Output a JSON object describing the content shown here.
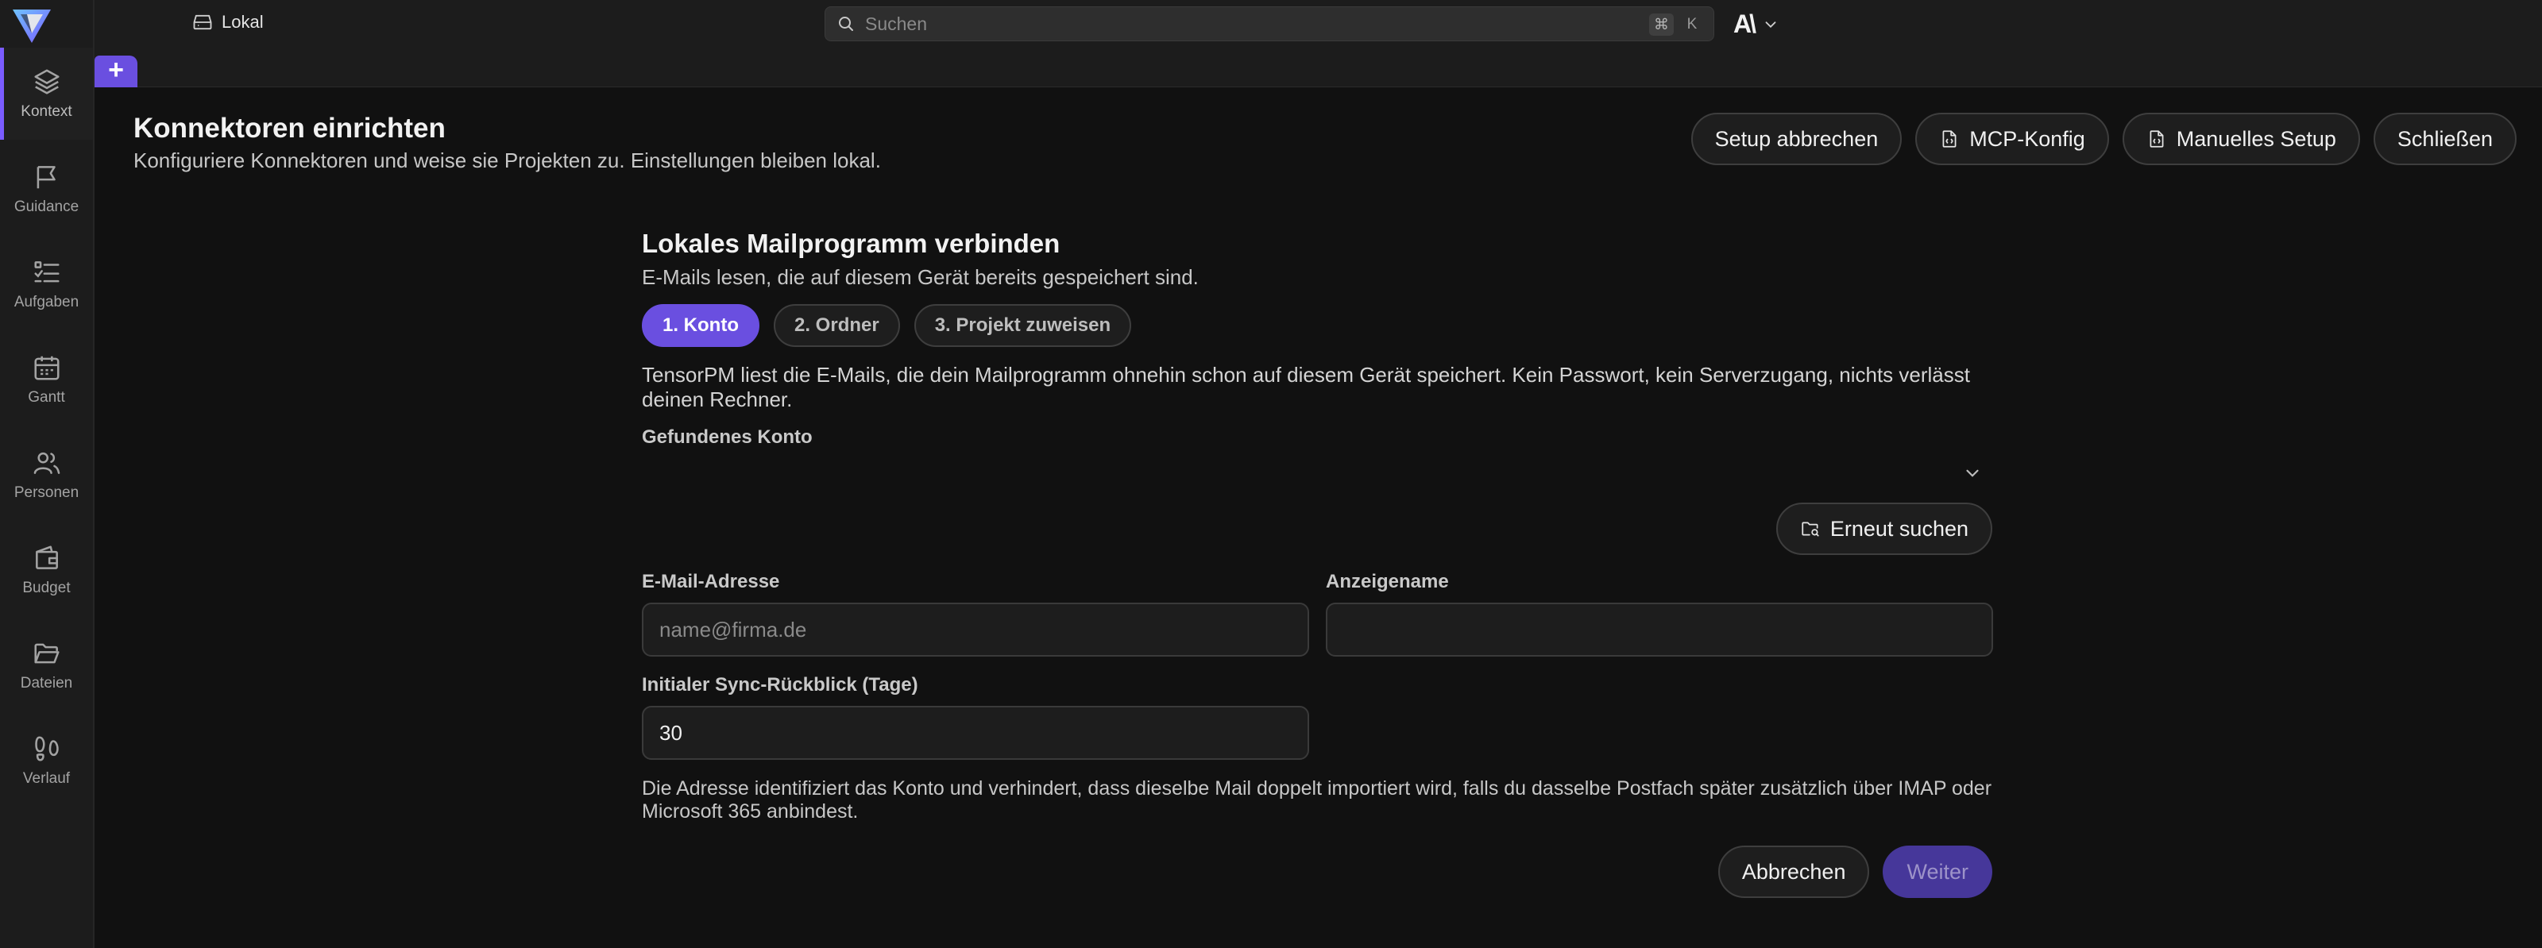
{
  "sidebar": {
    "items": [
      {
        "label": "Kontext",
        "icon": "layers-icon",
        "active": true
      },
      {
        "label": "Guidance",
        "icon": "flag-icon"
      },
      {
        "label": "Aufgaben",
        "icon": "checklist-icon"
      },
      {
        "label": "Gantt",
        "icon": "calendar-icon"
      },
      {
        "label": "Personen",
        "icon": "people-icon"
      },
      {
        "label": "Budget",
        "icon": "wallet-icon"
      },
      {
        "label": "Dateien",
        "icon": "folder-icon"
      },
      {
        "label": "Verlauf",
        "icon": "footsteps-icon"
      }
    ]
  },
  "topbar": {
    "location": "Lokal",
    "search_placeholder": "Suchen",
    "shortcut_modifier": "⌘",
    "shortcut_key": "K",
    "brand_mark": "A\\"
  },
  "tabs": {
    "add_label": "+"
  },
  "header": {
    "title": "Konnektoren einrichten",
    "subtitle": "Konfiguriere Konnektoren und weise sie Projekten zu. Einstellungen bleiben lokal.",
    "actions": {
      "cancel_setup": "Setup abbrechen",
      "mcp_config": "MCP-Konfig",
      "manual_setup": "Manuelles Setup",
      "close": "Schließen"
    }
  },
  "form": {
    "title": "Lokales Mailprogramm verbinden",
    "subtitle": "E-Mails lesen, die auf diesem Gerät bereits gespeichert sind.",
    "steps": [
      "1. Konto",
      "2. Ordner",
      "3. Projekt zuweisen"
    ],
    "intro": "TensorPM liest die E-Mails, die dein Mailprogramm ohnehin schon auf diesem Gerät speichert. Kein Passwort, kein Serverzugang, nichts verlässt deinen Rechner.",
    "found_account_label": "Gefundenes Konto",
    "rescan_label": "Erneut suchen",
    "email_label": "E-Mail-Adresse",
    "email_placeholder": "name@firma.de",
    "display_name_label": "Anzeigename",
    "display_name_value": "",
    "sync_label": "Initialer Sync-Rückblick (Tage)",
    "sync_value": "30",
    "hint": "Die Adresse identifiziert das Konto und verhindert, dass dieselbe Mail doppelt importiert wird, falls du dasselbe Postfach später zusätzlich über IMAP oder Microsoft 365 anbindest.",
    "cancel_label": "Abbrechen",
    "next_label": "Weiter"
  },
  "colors": {
    "accent": "#6a4fe0",
    "accent_disabled": "#46379a",
    "background": "#111111",
    "sidebar": "#1c1c1c"
  }
}
